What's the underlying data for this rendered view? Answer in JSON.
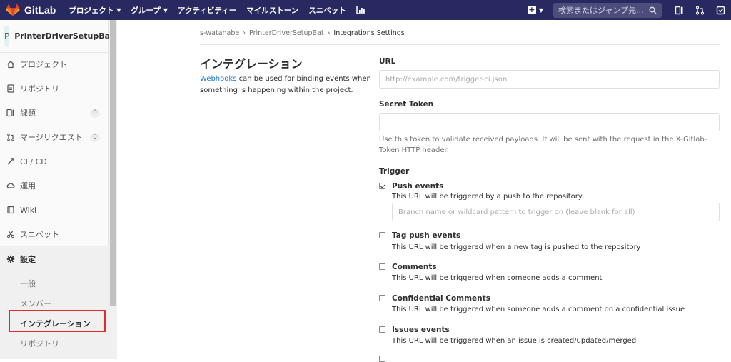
{
  "topbar": {
    "logo_text": "GitLab",
    "nav": [
      {
        "label": "プロジェクト",
        "caret": true
      },
      {
        "label": "グループ",
        "caret": true
      },
      {
        "label": "アクティビティー",
        "caret": false
      },
      {
        "label": "マイルストーン",
        "caret": false
      },
      {
        "label": "スニペット",
        "caret": false
      }
    ],
    "search_placeholder": "検索またはジャンプ先...",
    "colors": {
      "topbar_bg": "#292961",
      "logo_orange": "#fc6d26"
    }
  },
  "sidebar": {
    "avatar_letter": "P",
    "project_name": "PrinterDriverSetupBat",
    "items": [
      {
        "label": "プロジェクト",
        "icon": "home-icon"
      },
      {
        "label": "リポジトリ",
        "icon": "doc-icon"
      },
      {
        "label": "課題",
        "icon": "issues-icon",
        "count": "0"
      },
      {
        "label": "マージリクエスト",
        "icon": "merge-request-icon",
        "count": "0"
      },
      {
        "label": "CI / CD",
        "icon": "rocket-icon"
      },
      {
        "label": "運用",
        "icon": "cloud-icon"
      },
      {
        "label": "Wiki",
        "icon": "book-icon"
      },
      {
        "label": "スニペット",
        "icon": "scissors-icon"
      },
      {
        "label": "設定",
        "icon": "gear-icon"
      }
    ],
    "settings_sub": [
      {
        "label": "一般"
      },
      {
        "label": "メンバー"
      },
      {
        "label": "インテグレーション"
      },
      {
        "label": "リポジトリ"
      }
    ]
  },
  "breadcrumb": {
    "items": [
      "s-watanabe",
      "PrinterDriverSetupBat",
      "Integrations Settings"
    ]
  },
  "intro": {
    "title": "インテグレーション",
    "link": "Webhooks",
    "text": " can be used for binding events when something is happening within the project."
  },
  "form": {
    "url_label": "URL",
    "url_placeholder": "http://example.com/trigger-ci.json",
    "token_label": "Secret Token",
    "token_help": "Use this token to validate received payloads. It will be sent with the request in the X-Gitlab-Token HTTP header.",
    "trigger_label": "Trigger",
    "branch_placeholder": "Branch name or wildcard pattern to trigger on (leave blank for all)",
    "events": [
      {
        "title": "Push events",
        "desc": "This URL will be triggered by a push to the repository",
        "checked": true
      },
      {
        "title": "Tag push events",
        "desc": "This URL will be triggered when a new tag is pushed to the repository",
        "checked": false
      },
      {
        "title": "Comments",
        "desc": "This URL will be triggered when someone adds a comment",
        "checked": false
      },
      {
        "title": "Confidential Comments",
        "desc": "This URL will be triggered when someone adds a comment on a confidential issue",
        "checked": false
      },
      {
        "title": "Issues events",
        "desc": "This URL will be triggered when an issue is created/updated/merged",
        "checked": false
      }
    ]
  }
}
